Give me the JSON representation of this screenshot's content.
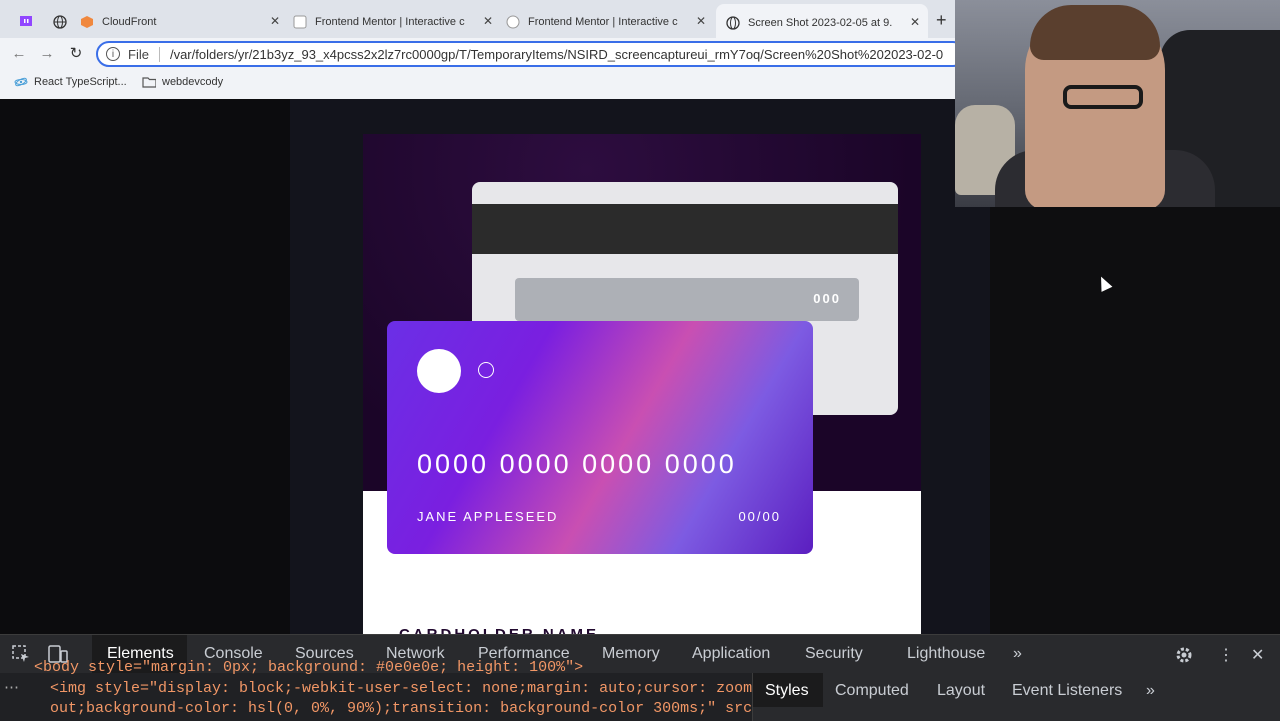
{
  "browser": {
    "tabs": [
      {
        "label": "CloudFront",
        "favicon": "cloudfront-icon"
      },
      {
        "label": "Frontend Mentor | Interactive c",
        "favicon": "fm-icon"
      },
      {
        "label": "Frontend Mentor | Interactive c",
        "favicon": "fm-icon"
      },
      {
        "label": "Screen Shot 2023-02-05 at 9.",
        "favicon": "globe-icon",
        "active": true
      }
    ],
    "address": {
      "scheme": "File",
      "url": "/var/folders/yr/21b3yz_93_x4pcss2x2lz7rc0000gp/T/TemporaryItems/NSIRD_screencaptureui_rmY7oq/Screen%20Shot%202023-02-0"
    },
    "bookmarks": [
      {
        "label": "React TypeScript...",
        "icon": "react-icon"
      },
      {
        "label": "webdevcody",
        "icon": "folder-icon"
      }
    ]
  },
  "card_back": {
    "cvc": "000"
  },
  "card_front": {
    "number": "0000 0000 0000 0000",
    "name": "JANE APPLESEED",
    "expiry": "00/00"
  },
  "form": {
    "cardholder_label": "CARDHOLDER NAME"
  },
  "devtools": {
    "tabs": [
      "Elements",
      "Console",
      "Sources",
      "Network",
      "Performance",
      "Memory",
      "Application",
      "Security",
      "Lighthouse"
    ],
    "more": "»",
    "code_line1": "<body style=\"margin: 0px; background: #0e0e0e; height: 100%\">",
    "code_line2": "<img style=\"display: block;-webkit-user-select: none;margin: auto;cursor: zoom-",
    "code_line3": "out;background-color: hsl(0, 0%, 90%);transition: background-color 300ms;\" src=",
    "styles_tabs": [
      "Styles",
      "Computed",
      "Layout",
      "Event Listeners"
    ],
    "styles_more": "»"
  },
  "colors": {
    "accent": "#3a6ee8",
    "card_gradient_start": "#6b2fe6",
    "card_gradient_end": "#5b1ec0"
  }
}
